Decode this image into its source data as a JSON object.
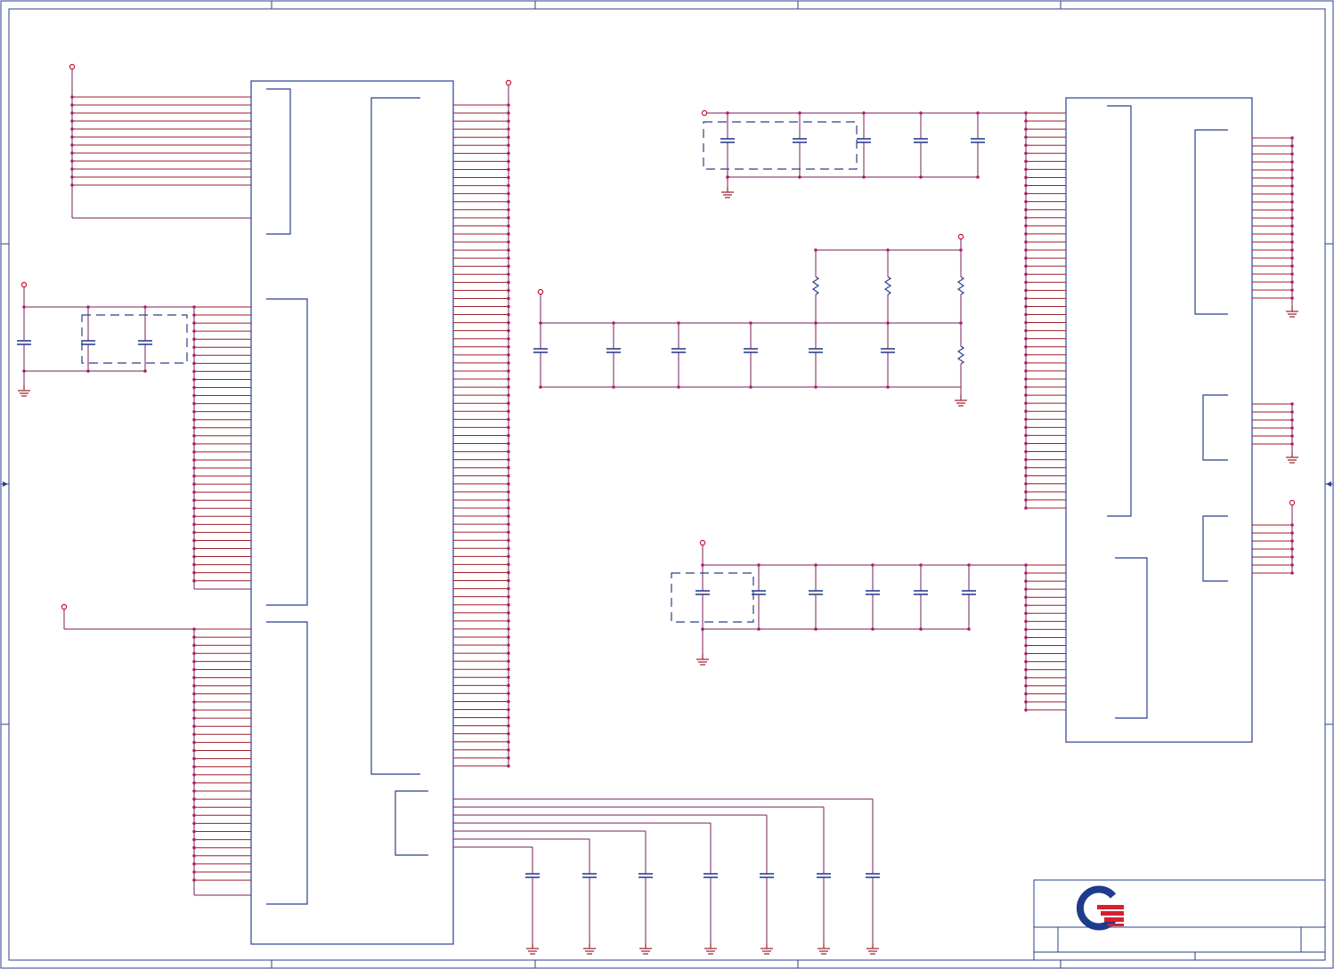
{
  "sheet": {
    "width_units": 1498,
    "height_units": 1089,
    "columns": 5,
    "rows": 4
  },
  "colors": {
    "component_outline": "#2b3f8f",
    "wire": "#9b1f2a",
    "net": "#7a1f5a",
    "junction": "#b0206a",
    "power_port": "#c8102e",
    "logo_red": "#d62031",
    "logo_blue": "#1e3c8c"
  },
  "title_block": {
    "logo": "company-logo"
  }
}
